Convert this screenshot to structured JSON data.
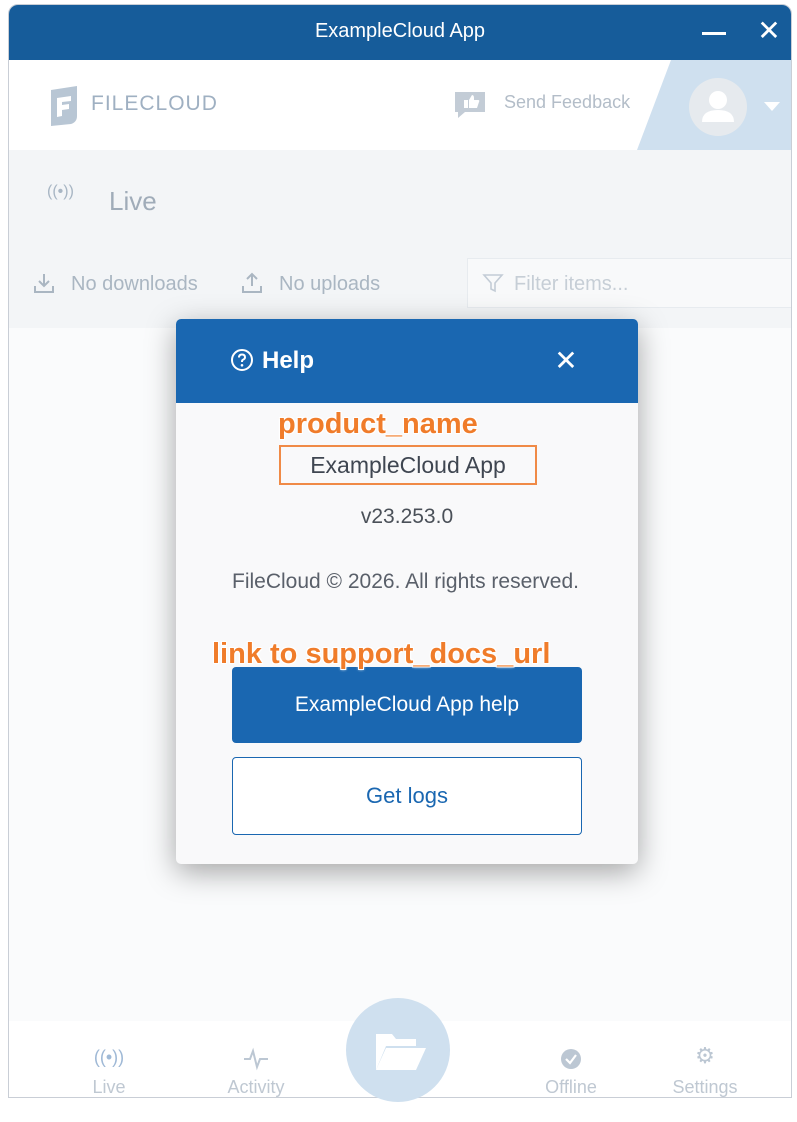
{
  "window": {
    "title": "ExampleCloud App"
  },
  "topbar": {
    "logo_text": "FILECLOUD",
    "feedback_label": "Send Feedback"
  },
  "live": {
    "title": "Live",
    "downloads_label": "No downloads",
    "uploads_label": "No uploads",
    "filter_placeholder": "Filter items..."
  },
  "modal": {
    "title": "Help",
    "close_glyph": "✕",
    "product_name": "ExampleCloud App",
    "version": "v23.253.0",
    "copyright": "FileCloud © 2026. All rights reserved.",
    "help_button_label": "ExampleCloud App help",
    "logs_button_label": "Get logs"
  },
  "annotations": {
    "product_name": "product_name",
    "support_link": "link to support_docs_url"
  },
  "bottom_nav": {
    "items": [
      {
        "label": "Live",
        "icon": "live-icon"
      },
      {
        "label": "Activity",
        "icon": "activity-icon"
      },
      {
        "label": "Offline",
        "icon": "offline-check-icon"
      },
      {
        "label": "Settings",
        "icon": "settings-gear-icon"
      }
    ],
    "center_icon": "folder-open-icon"
  },
  "colors": {
    "brand_blue": "#1a67b1",
    "titlebar": "#165c9a",
    "annotation": "#f07c2a"
  }
}
